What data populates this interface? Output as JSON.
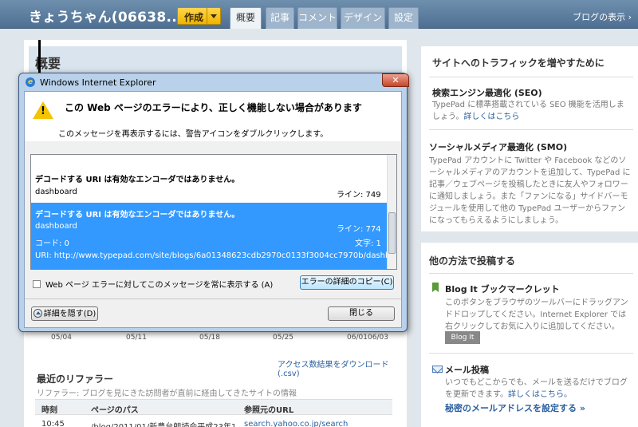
{
  "header": {
    "blog_title": "きょうちゃん(06638...",
    "create_label": "作成",
    "tabs": [
      "概要",
      "記事",
      "コメント",
      "デザイン",
      "設定"
    ],
    "view_blog": "ブログの表示"
  },
  "main": {
    "title": "概要",
    "chart_dates": [
      "05/04",
      "05/11",
      "05/18",
      "05/25",
      "06/01",
      "06/03"
    ],
    "download_link": "アクセス数結果をダウンロード(.csv)",
    "referrers": {
      "title": "最近のリファラー",
      "desc": "リファラー: ブログを見にきた訪問者が直前に経由してきたサイトの情報",
      "col_time": "時刻",
      "col_path": "ページのパス",
      "col_source": "参照元のURL",
      "row_time": "10:45",
      "row_path": "/blog/2011/01/新豊台朗読会平成23年1",
      "row_source": "search.yahoo.co.jp/search"
    }
  },
  "sidebar": {
    "traffic_title": "サイトへのトラフィックを増やすために",
    "seo_title": "検索エンジン最適化 (SEO)",
    "seo_desc_1": "TypePad に標準搭載されている SEO 機能を活用しましょう。",
    "seo_link": "詳しくはこちら",
    "smo_title": "ソーシャルメディア最適化 (SMO)",
    "smo_desc": "TypePad アカウントに Twitter や Facebook などのソーシャルメディアのアカウントを追加して、TypePad に記事／ウェブページを投稿したときに友人やフォロワーに通知しましょう。また「ファンになる」サイドバーモジュールを使用して他の TypePad ユーザーからファンになってもらえるようにしましょう。",
    "other_title": "他の方法で投稿する",
    "blogit_title": "Blog It ブックマークレット",
    "blogit_desc": "このボタンをブラウザのツールバーにドラッグアンドドロップしてください。Internet Explorer では 右クリックしてお気に入りに追加してください。",
    "blogit_btn": "Blog It",
    "mail_title": "メール投稿",
    "mail_desc": "いつでもどこからでも、メールを送るだけでブログを更新できます。",
    "mail_link": "詳しくはこちら。",
    "secret_link": "秘密のメールアドレスを設定する »"
  },
  "dialog": {
    "window_title": "Windows Internet Explorer",
    "heading": "この Web ページのエラーにより、正しく機能しない場合があります",
    "subtext": "このメッセージを再表示するには、警告アイコンをダブルクリックします。",
    "error1": {
      "message": "デコードする URI は有効なエンコーダではありません。",
      "file": "dashboard",
      "line": "ライン: 749"
    },
    "error2": {
      "message": "デコードする URI は有効なエンコーダではありません。",
      "file": "dashboard",
      "line": "ライン: 774",
      "code": "コード: 0",
      "char": "文字: 1",
      "uri": "URI: http://www.typepad.com/site/blogs/6a01348623cdb2970c0133f3004cc7970b/dashboard"
    },
    "checkbox_label": "Web ページ エラーに対してこのメッセージを常に表示する (A)",
    "copy_button": "エラーの詳細のコピー(C)",
    "details_button": "詳細を隠す(D)",
    "close_button": "閉じる"
  }
}
